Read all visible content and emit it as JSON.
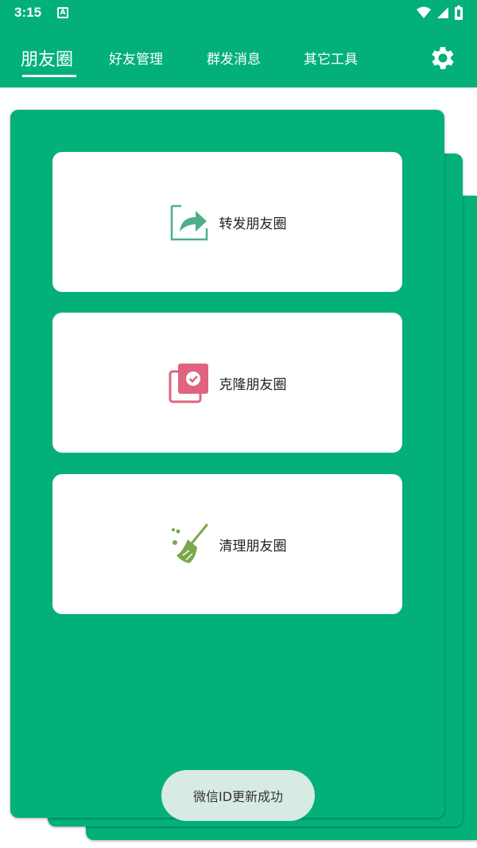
{
  "status_bar": {
    "time": "3:15",
    "notification_icon": "a-icon"
  },
  "nav": {
    "tabs": [
      {
        "label": "朋友圈",
        "active": true
      },
      {
        "label": "好友管理",
        "active": false
      },
      {
        "label": "群发消息",
        "active": false
      },
      {
        "label": "其它工具",
        "active": false
      }
    ],
    "settings_icon": "gear-icon"
  },
  "features": [
    {
      "label": "转发朋友圈",
      "icon": "share-icon",
      "color": "#4caf88"
    },
    {
      "label": "克隆朋友圈",
      "icon": "clone-icon",
      "color": "#e0637f"
    },
    {
      "label": "清理朋友圈",
      "icon": "broom-icon",
      "color": "#7aa84a"
    }
  ],
  "toast": {
    "message": "微信ID更新成功"
  },
  "colors": {
    "brand": "#03b07a",
    "card": "#ffffff",
    "toast_bg": "#d7ebe3"
  }
}
